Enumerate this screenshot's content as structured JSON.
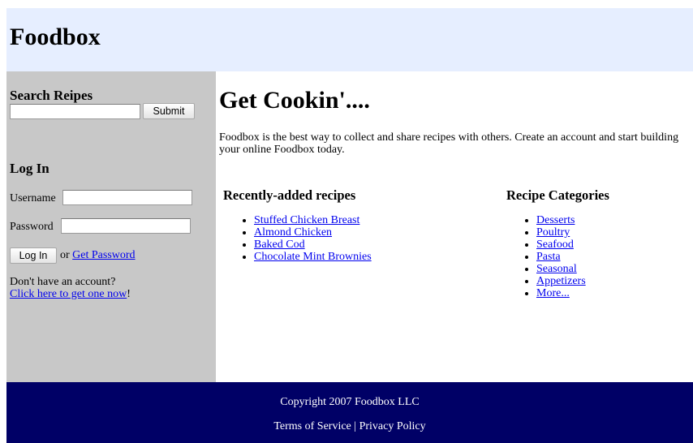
{
  "header": {
    "brand": "Foodbox"
  },
  "sidebar": {
    "search_heading": "Search Reipes",
    "search_value": "",
    "search_button": "Submit",
    "login_heading": "Log In",
    "username_label": "Username",
    "username_value": "",
    "password_label": "Password",
    "password_value": "",
    "login_button": "Log In",
    "or_text": "or",
    "get_password_link": "Get Password",
    "no_account_text": "Don't have an account?",
    "signup_link": "Click here to get one now",
    "signup_suffix": "!"
  },
  "main": {
    "title": "Get Cookin'....",
    "intro": "Foodbox is the best way to collect and share recipes with others. Create an account and start building your online Foodbox today.",
    "recent": {
      "heading": "Recently-added recipes",
      "items": [
        "Stuffed Chicken Breast",
        "Almond Chicken",
        "Baked Cod",
        "Chocolate Mint Brownies"
      ]
    },
    "categories": {
      "heading": "Recipe Categories",
      "items": [
        "Desserts",
        "Poultry",
        "Seafood",
        "Pasta",
        "Seasonal",
        "Appetizers",
        "More..."
      ]
    }
  },
  "footer": {
    "copyright": "Copyright 2007 Foodbox LLC",
    "terms_link": "Terms of Service",
    "separator": "|",
    "privacy_link": "Privacy Policy"
  },
  "colors": {
    "header_bg": "#e6eeff",
    "sidebar_bg": "#c8c8c8",
    "footer_bg": "#000066",
    "link": "#0000ee"
  }
}
